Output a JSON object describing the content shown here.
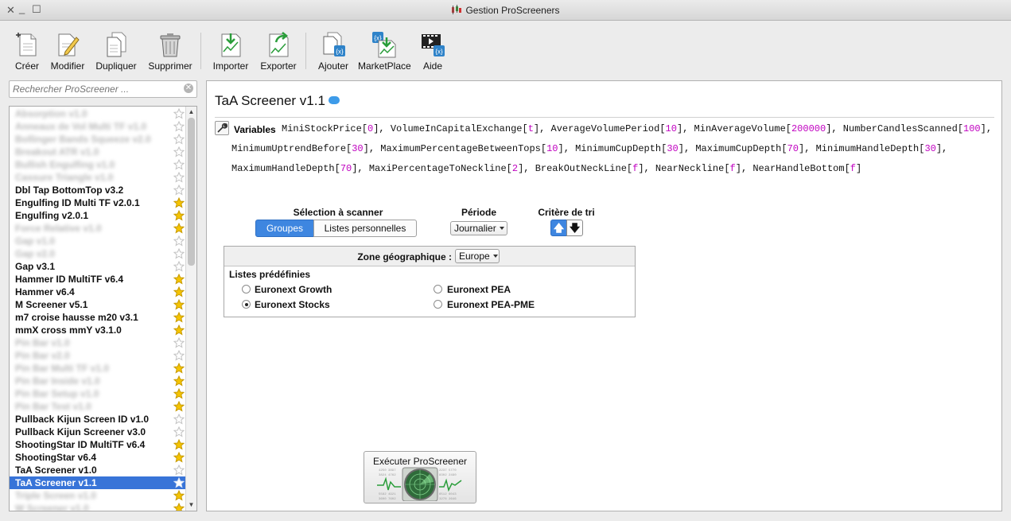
{
  "window": {
    "title": "Gestion ProScreeners"
  },
  "toolbar": {
    "buttons": [
      {
        "label": "Créer",
        "icon": "new-document-icon"
      },
      {
        "label": "Modifier",
        "icon": "edit-document-icon"
      },
      {
        "label": "Dupliquer",
        "icon": "duplicate-document-icon"
      },
      {
        "label": "Supprimer",
        "icon": "trash-icon"
      },
      {
        "label": "Importer",
        "icon": "import-icon"
      },
      {
        "label": "Exporter",
        "icon": "export-icon"
      },
      {
        "label": "Ajouter",
        "icon": "add-screener-icon"
      },
      {
        "label": "MarketPlace",
        "icon": "marketplace-icon"
      },
      {
        "label": "Aide",
        "icon": "help-video-icon"
      }
    ]
  },
  "search": {
    "placeholder": "Rechercher ProScreener ..."
  },
  "screeners": [
    {
      "name": "Absorption v1.0",
      "starred": false,
      "blurred": true
    },
    {
      "name": "Anneaux de Vol Multi TF v1.0",
      "starred": false,
      "blurred": true
    },
    {
      "name": "Bollinger Bands Squeeze v2.0",
      "starred": false,
      "blurred": true
    },
    {
      "name": "Breakout ATR v1.0",
      "starred": false,
      "blurred": true
    },
    {
      "name": "Bullish Engulfing v1.0",
      "starred": false,
      "blurred": true
    },
    {
      "name": "Cassure Triangle v1.0",
      "starred": false,
      "blurred": true
    },
    {
      "name": "Dbl Tap BottomTop v3.2",
      "starred": false,
      "blurred": false
    },
    {
      "name": "Engulfing ID Multi TF v2.0.1",
      "starred": true,
      "blurred": false
    },
    {
      "name": "Engulfing v2.0.1",
      "starred": true,
      "blurred": false
    },
    {
      "name": "Force Relative v1.0",
      "starred": true,
      "blurred": true
    },
    {
      "name": "Gap v1.0",
      "starred": false,
      "blurred": true
    },
    {
      "name": "Gap v2.0",
      "starred": false,
      "blurred": true
    },
    {
      "name": "Gap v3.1",
      "starred": false,
      "blurred": false
    },
    {
      "name": "Hammer ID MultiTF v6.4",
      "starred": true,
      "blurred": false
    },
    {
      "name": "Hammer v6.4",
      "starred": true,
      "blurred": false
    },
    {
      "name": "M Screener v5.1",
      "starred": true,
      "blurred": false
    },
    {
      "name": "m7 croise hausse m20 v3.1",
      "starred": true,
      "blurred": false
    },
    {
      "name": "mmX cross mmY v3.1.0",
      "starred": true,
      "blurred": false
    },
    {
      "name": "Pin Bar v1.0",
      "starred": false,
      "blurred": true
    },
    {
      "name": "Pin Bar v2.0",
      "starred": false,
      "blurred": true
    },
    {
      "name": "Pin Bar Multi TF v1.0",
      "starred": true,
      "blurred": true
    },
    {
      "name": "Pin Bar Inside v1.0",
      "starred": true,
      "blurred": true
    },
    {
      "name": "Pin Bar Setup v1.0",
      "starred": true,
      "blurred": true
    },
    {
      "name": "Pin Bar Test v1.0",
      "starred": true,
      "blurred": true
    },
    {
      "name": "Pullback Kijun Screen ID v1.0",
      "starred": false,
      "blurred": false
    },
    {
      "name": "Pullback Kijun Screener v3.0",
      "starred": false,
      "blurred": false
    },
    {
      "name": "ShootingStar ID MultiTF v6.4",
      "starred": true,
      "blurred": false
    },
    {
      "name": "ShootingStar v6.4",
      "starred": true,
      "blurred": false
    },
    {
      "name": "TaA Screener v1.0",
      "starred": false,
      "blurred": false
    },
    {
      "name": "TaA Screener v1.1",
      "starred": false,
      "blurred": false,
      "selected": true
    },
    {
      "name": "Triple Screen v1.0",
      "starred": true,
      "blurred": true
    },
    {
      "name": "W Screener v1.0",
      "starred": true,
      "blurred": true
    }
  ],
  "panel": {
    "title": "TaA Screener v1.1",
    "variables_label": "Variables",
    "variables": [
      {
        "name": "MiniStockPrice",
        "value": "0"
      },
      {
        "name": "VolumeInCapitalExchange",
        "value": "t"
      },
      {
        "name": "AverageVolumePeriod",
        "value": "10"
      },
      {
        "name": "MinAverageVolume",
        "value": "200000"
      },
      {
        "name": "NumberCandlesScanned",
        "value": "100"
      },
      {
        "name": "MinimumUptrendBefore",
        "value": "30"
      },
      {
        "name": "MaximumPercentageBetweenTops",
        "value": "10"
      },
      {
        "name": "MinimumCupDepth",
        "value": "30"
      },
      {
        "name": "MaximumCupDepth",
        "value": "70"
      },
      {
        "name": "MinimumHandleDepth",
        "value": "30"
      },
      {
        "name": "MaximumHandleDepth",
        "value": "70"
      },
      {
        "name": "MaxiPercentageToNeckline",
        "value": "2"
      },
      {
        "name": "BreakOutNeckLine",
        "value": "f"
      },
      {
        "name": "NearNeckline",
        "value": "f"
      },
      {
        "name": "NearHandleBottom",
        "value": "f"
      }
    ],
    "selection_label": "Sélection à scanner",
    "tab_groups": "Groupes",
    "tab_lists": "Listes personnelles",
    "period_label": "Période",
    "period_value": "Journalier",
    "sort_label": "Critère de tri",
    "sort_up": "🡅",
    "sort_down": "🡇",
    "zone_label": "Zone géographique :",
    "zone_value": "Europe",
    "predefined_label": "Listes prédéfinies",
    "radios": [
      {
        "label": "Euronext Growth",
        "checked": false
      },
      {
        "label": "Euronext PEA",
        "checked": false
      },
      {
        "label": "Euronext Stocks",
        "checked": true
      },
      {
        "label": "Euronext PEA-PME",
        "checked": false
      }
    ],
    "execute_label": "Exécuter ProScreener"
  },
  "colors": {
    "accent": "#3874d8",
    "value_magenta": "#c000c0",
    "star": "#f5c400"
  }
}
